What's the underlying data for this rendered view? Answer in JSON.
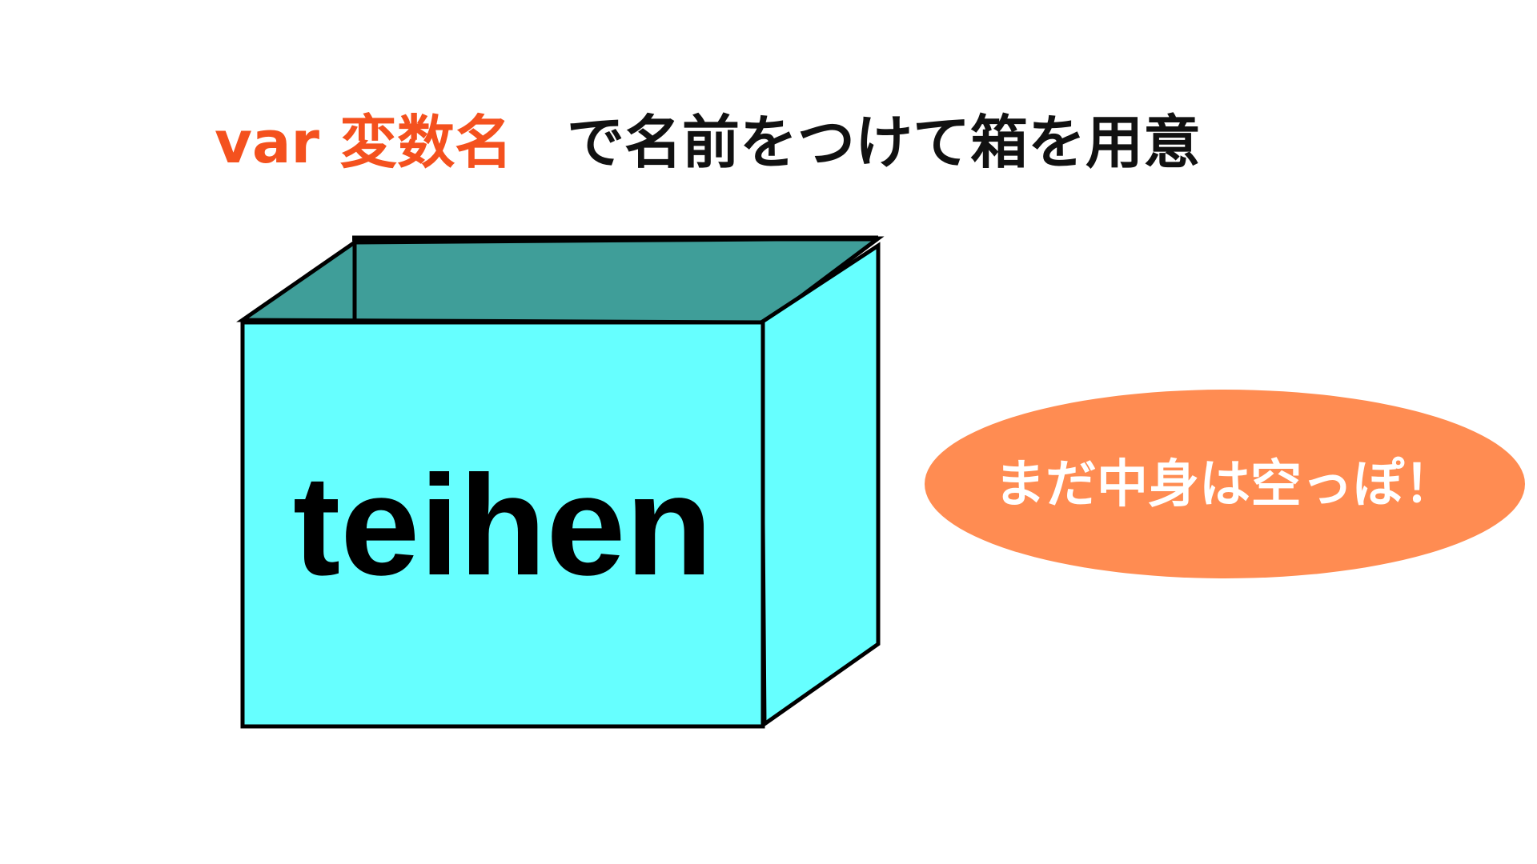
{
  "heading": {
    "keyword": "var 変数名",
    "rest": "で名前をつけて箱を用意"
  },
  "box": {
    "label": "teihen"
  },
  "bubble": {
    "text": "まだ中身は空っぽ！"
  },
  "colors": {
    "keyword": "#f4511e",
    "heading": "#111111",
    "box_front": "#66ffff",
    "box_inside": "#3f9e99",
    "box_outline": "#000000",
    "bubble": "#ff8c52",
    "bubble_text": "#ffffff"
  }
}
